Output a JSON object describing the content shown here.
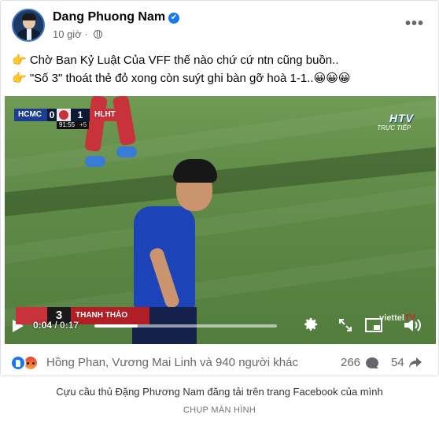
{
  "post": {
    "author": "Dang Phuong Nam",
    "verified_badge": "✔",
    "timestamp": "10 giờ",
    "separator": "·",
    "more_icon": "more-dots-icon",
    "text_lines": [
      "👉 Chờ Ban Kỷ Luật Của VFF thế nào chứ cứ ntn cũng buồn..",
      "👉 \"Số 3\" thoát thẻ đỏ xong còn suýt ghi bàn gỡ hoà 1-1..😀😀😀"
    ]
  },
  "video": {
    "scoreboard": {
      "team_home": "HCMC",
      "score_home": "0",
      "score_away": "1",
      "team_away": "HLHT",
      "clock": "91:55",
      "added_time": "+5"
    },
    "broadcaster_logo": "HTV",
    "broadcaster_sub": "TRỰC TIẾP",
    "lower_third": {
      "number": "3",
      "player_name": "THANH THẢO"
    },
    "player": {
      "current_time": "0:04",
      "duration": "0:17",
      "progress": 0.235
    },
    "watermark": "viettel",
    "watermark_tv": "TV",
    "colors": {
      "pitch": "#5f8a47",
      "home_jersey": "#1d43b8",
      "away_jersey": "#c8323a"
    }
  },
  "footer": {
    "reaction_icons": [
      "like-icon",
      "angry-icon"
    ],
    "reacted_by": "Hồng Phan, Vương Mai Linh và 940 người khác",
    "comment_count": "266",
    "share_count": "54"
  },
  "caption": "Cựu cầu thủ Đặng Phương Nam đăng tải trên trang Facebook của mình",
  "credit": "CHỤP MÀN HÌNH",
  "accent": "#1877f2"
}
